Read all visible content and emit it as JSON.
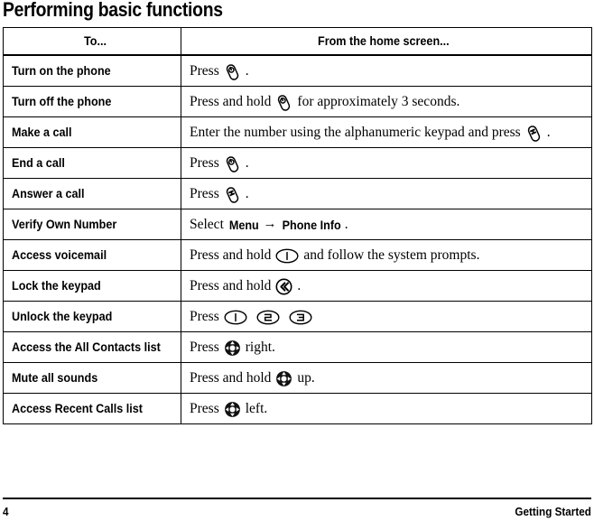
{
  "page": {
    "title": "Performing basic functions"
  },
  "table": {
    "headers": {
      "col1": "To...",
      "col2": "From the home screen..."
    },
    "rows": [
      {
        "label": "Turn on the phone",
        "parts": [
          {
            "kind": "text",
            "value": "Press"
          },
          {
            "kind": "icon",
            "value": "power-end-key-icon"
          },
          {
            "kind": "text",
            "value": "."
          }
        ]
      },
      {
        "label": "Turn off the phone",
        "parts": [
          {
            "kind": "text",
            "value": "Press and hold"
          },
          {
            "kind": "icon",
            "value": "power-end-key-icon"
          },
          {
            "kind": "text",
            "value": "for approximately 3 seconds."
          }
        ]
      },
      {
        "label": "Make a call",
        "parts": [
          {
            "kind": "text",
            "value": "Enter the number using the alphanumeric keypad and press"
          },
          {
            "kind": "icon",
            "value": "send-call-key-icon"
          },
          {
            "kind": "text",
            "value": "."
          }
        ]
      },
      {
        "label": "End a call",
        "parts": [
          {
            "kind": "text",
            "value": "Press"
          },
          {
            "kind": "icon",
            "value": "power-end-key-icon"
          },
          {
            "kind": "text",
            "value": "."
          }
        ]
      },
      {
        "label": "Answer a call",
        "parts": [
          {
            "kind": "text",
            "value": "Press"
          },
          {
            "kind": "icon",
            "value": "send-call-key-icon"
          },
          {
            "kind": "text",
            "value": "."
          }
        ]
      },
      {
        "label": "Verify Own Number",
        "parts": [
          {
            "kind": "text",
            "value": "Select"
          },
          {
            "kind": "menu",
            "value": "Menu"
          },
          {
            "kind": "arrow",
            "value": "→"
          },
          {
            "kind": "menu",
            "value": "Phone Info"
          },
          {
            "kind": "text",
            "value": "."
          }
        ]
      },
      {
        "label": "Access voicemail",
        "parts": [
          {
            "kind": "text",
            "value": "Press and hold"
          },
          {
            "kind": "icon",
            "value": "key-1-icon"
          },
          {
            "kind": "text",
            "value": "and follow the system prompts."
          }
        ]
      },
      {
        "label": "Lock the keypad",
        "parts": [
          {
            "kind": "text",
            "value": "Press and hold"
          },
          {
            "kind": "icon",
            "value": "back-double-chevron-key-icon"
          },
          {
            "kind": "text",
            "value": "."
          }
        ]
      },
      {
        "label": "Unlock the keypad",
        "parts": [
          {
            "kind": "text",
            "value": "Press"
          },
          {
            "kind": "icon",
            "value": "key-1-icon"
          },
          {
            "kind": "icon",
            "value": "key-2-icon"
          },
          {
            "kind": "icon",
            "value": "key-3-icon"
          }
        ]
      },
      {
        "label": "Access the All Contacts list",
        "parts": [
          {
            "kind": "text",
            "value": "Press"
          },
          {
            "kind": "icon",
            "value": "navigation-key-icon"
          },
          {
            "kind": "text",
            "value": "right."
          }
        ]
      },
      {
        "label": "Mute all sounds",
        "parts": [
          {
            "kind": "text",
            "value": "Press and hold"
          },
          {
            "kind": "icon",
            "value": "navigation-key-icon"
          },
          {
            "kind": "text",
            "value": "up."
          }
        ]
      },
      {
        "label": "Access Recent Calls list",
        "parts": [
          {
            "kind": "text",
            "value": "Press"
          },
          {
            "kind": "icon",
            "value": "navigation-key-icon"
          },
          {
            "kind": "text",
            "value": "left."
          }
        ]
      }
    ]
  },
  "footer": {
    "page_number": "4",
    "section": "Getting Started"
  },
  "colors": {
    "text": "#000000",
    "rule": "#000000",
    "background": "#ffffff"
  }
}
